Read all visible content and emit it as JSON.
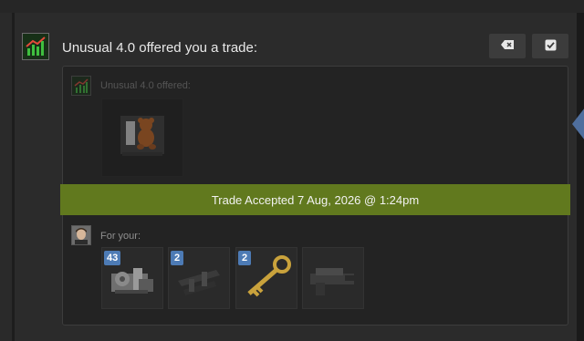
{
  "notification": {
    "title": "Unusual 4.0 offered you a trade:",
    "actions": {
      "delete_icon": "delete-tag-icon",
      "mark_read_icon": "checkbox-icon"
    }
  },
  "offer": {
    "them_label": "Unusual 4.0 offered:",
    "you_label": "For your:",
    "accepted_text": "Trade Accepted 7 Aug, 2026 @ 1:24pm",
    "their_items": [
      {
        "icon": "teddy-bear-taunt-icon"
      }
    ],
    "your_items": [
      {
        "badge": "43",
        "icon": "scrap-metal-icon"
      },
      {
        "badge": "2",
        "icon": "weapon-parts-icon"
      },
      {
        "badge": "2",
        "icon": "crate-key-icon"
      },
      {
        "badge": "",
        "icon": "gun-icon"
      }
    ]
  },
  "colors": {
    "accepted_banner": "#61791e",
    "badge": "#4d7bb5",
    "background": "#1b1b1b",
    "panel": "#2b2b2b"
  }
}
